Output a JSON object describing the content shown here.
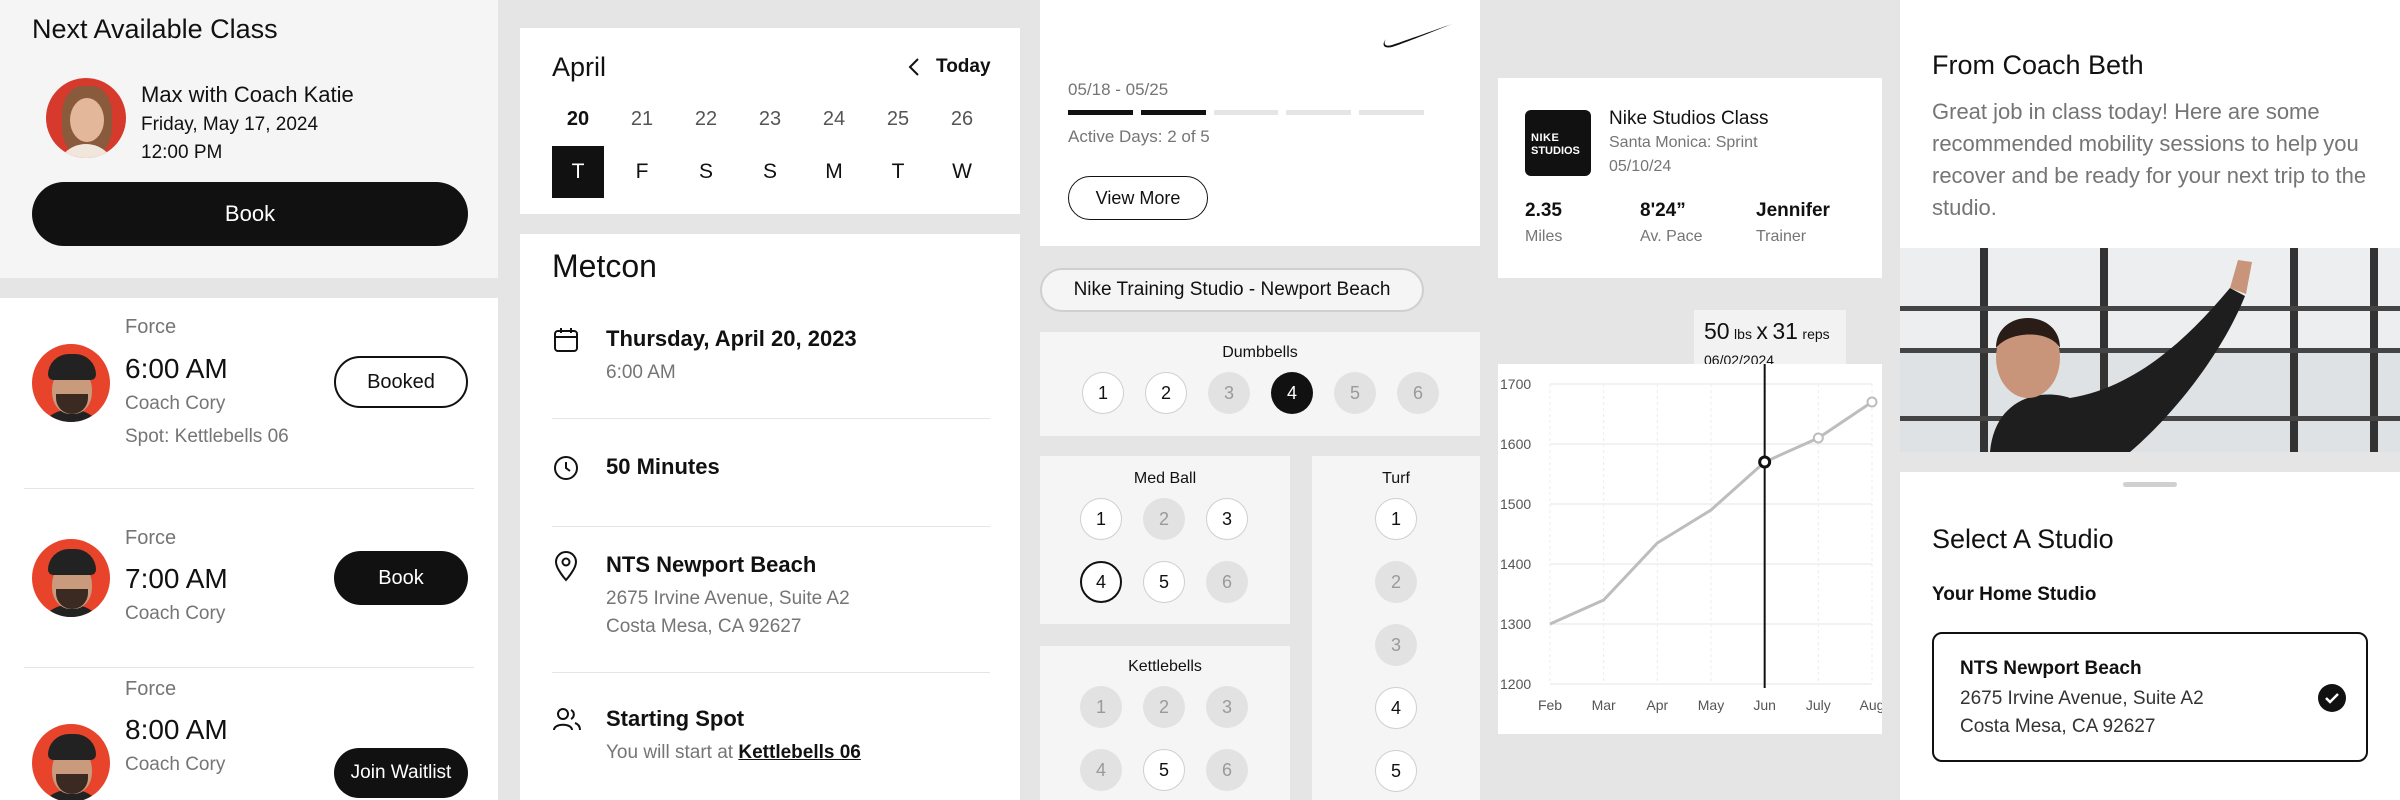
{
  "next_class": {
    "title": "Next Available Class",
    "name": "Max with Coach Katie",
    "date": "Friday, May 17, 2024",
    "time": "12:00 PM",
    "book_label": "Book"
  },
  "class_list": [
    {
      "type": "Force",
      "time": "6:00 AM",
      "coach": "Coach Cory",
      "spot": "Spot: Kettlebells 06",
      "action": "Booked",
      "style": "outline"
    },
    {
      "type": "Force",
      "time": "7:00 AM",
      "coach": "Coach Cory",
      "spot": "",
      "action": "Book",
      "style": "solid"
    },
    {
      "type": "Force",
      "time": "8:00 AM",
      "coach": "Coach Cory",
      "spot": "",
      "action": "Join Waitlist",
      "style": "solid"
    }
  ],
  "calendar": {
    "month": "April",
    "today_label": "Today",
    "dates": [
      "20",
      "21",
      "22",
      "23",
      "24",
      "25",
      "26"
    ],
    "weekdays": [
      "T",
      "F",
      "S",
      "S",
      "M",
      "T",
      "W"
    ],
    "selected_index": 0
  },
  "metcon": {
    "title": "Metcon",
    "date": "Thursday, April 20, 2023",
    "time": "6:00 AM",
    "duration": "50 Minutes",
    "location_name": "NTS Newport Beach",
    "address_line1": "2675 Irvine Avenue, Suite A2",
    "address_line2": "Costa Mesa, CA 92627",
    "spot_title": "Starting Spot",
    "spot_prefix": "You will start at",
    "spot_link": "Kettlebells 06"
  },
  "streak": {
    "range": "05/18 - 05/25",
    "active_days": "Active Days: 2 of 5",
    "segments_total": 5,
    "segments_done": 2,
    "view_more": "View More"
  },
  "studio_chip": "Nike Training Studio - Newport Beach",
  "spots": {
    "dumbbells": {
      "label": "Dumbbells",
      "items": [
        {
          "n": "1",
          "s": "on"
        },
        {
          "n": "2",
          "s": "on"
        },
        {
          "n": "3",
          "s": "off"
        },
        {
          "n": "4",
          "s": "sel"
        },
        {
          "n": "5",
          "s": "off"
        },
        {
          "n": "6",
          "s": "off"
        }
      ]
    },
    "medball": {
      "label": "Med Ball",
      "items": [
        {
          "n": "1",
          "s": "on"
        },
        {
          "n": "2",
          "s": "off"
        },
        {
          "n": "3",
          "s": "on"
        },
        {
          "n": "4",
          "s": "ring"
        },
        {
          "n": "5",
          "s": "on"
        },
        {
          "n": "6",
          "s": "off"
        }
      ]
    },
    "kettlebells": {
      "label": "Kettlebells",
      "items": [
        {
          "n": "1",
          "s": "off"
        },
        {
          "n": "2",
          "s": "off"
        },
        {
          "n": "3",
          "s": "off"
        },
        {
          "n": "4",
          "s": "off"
        },
        {
          "n": "5",
          "s": "on"
        },
        {
          "n": "6",
          "s": "off"
        }
      ]
    },
    "turf": {
      "label": "Turf",
      "items": [
        {
          "n": "1",
          "s": "on"
        },
        {
          "n": "2",
          "s": "off"
        },
        {
          "n": "3",
          "s": "off"
        },
        {
          "n": "4",
          "s": "on"
        },
        {
          "n": "5",
          "s": "on"
        }
      ]
    }
  },
  "class_summary": {
    "logo_line1": "NIKE",
    "logo_line2": "STUDIOS",
    "title": "Nike Studios Class",
    "subtitle": "Santa Monica: Sprint",
    "date": "05/10/24",
    "stats": [
      {
        "value": "2.35",
        "label": "Miles"
      },
      {
        "value": "8'24”",
        "label": "Av. Pace"
      },
      {
        "value": "Jennifer",
        "label": "Trainer"
      }
    ]
  },
  "tooltip": {
    "value": "50",
    "unit1": "lbs",
    "x": "x",
    "reps_value": "31",
    "unit2": "reps",
    "date": "06/02/2024"
  },
  "chart_data": {
    "type": "line",
    "categories": [
      "Feb",
      "Mar",
      "Apr",
      "May",
      "Jun",
      "July",
      "Aug"
    ],
    "values": [
      1300,
      1340,
      1435,
      1490,
      1570,
      1610,
      1670
    ],
    "ylim": [
      1200,
      1700
    ],
    "yticks": [
      "1700",
      "1600",
      "1500",
      "1400",
      "1300",
      "1200"
    ],
    "highlight_index": 4,
    "grid": true
  },
  "coach_note": {
    "title": "From Coach Beth",
    "body": "Great job in class today! Here are some recommended mobility sessions to help you recover and be ready for your next trip to the studio."
  },
  "select_studio": {
    "title": "Select A Studio",
    "subtitle": "Your Home Studio",
    "name": "NTS Newport Beach",
    "line1": "2675 Irvine Avenue, Suite A2",
    "line2": "Costa Mesa, CA 92627"
  }
}
